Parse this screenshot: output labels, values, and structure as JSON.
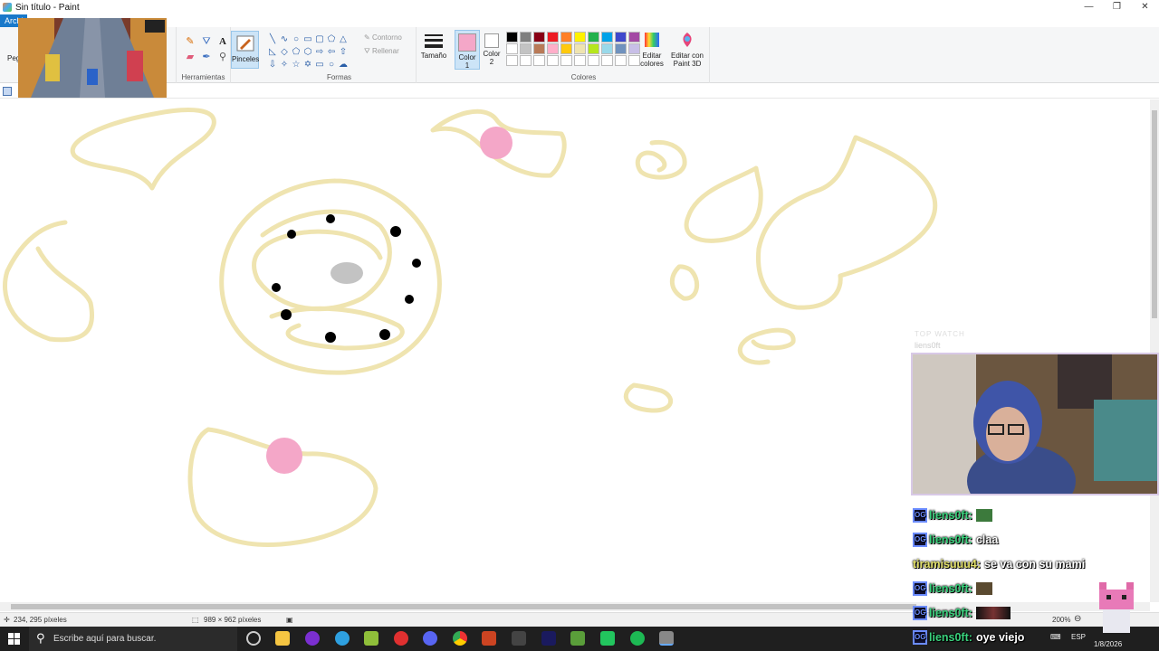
{
  "window": {
    "title": "Sin título - Paint",
    "controls": [
      "—",
      "❐",
      "✕"
    ]
  },
  "ribbon": {
    "file_tab": "Archivo",
    "paste_label": "Pegar",
    "groups": {
      "tools_label": "Herramientas",
      "shapes_label": "Formas",
      "colors_label": "Colores"
    },
    "brushes_label": "Pinceles",
    "outline_label": "Contorno",
    "fill_label": "Rellenar",
    "size_label": "Tamaño",
    "color1_label": "Color",
    "color1_num": "1",
    "color2_label": "Color",
    "color2_num": "2",
    "edit_colors_line1": "Editar",
    "edit_colors_line2": "colores",
    "paint3d_line1": "Editar con",
    "paint3d_line2": "Paint 3D",
    "color1": "#f4a7c8",
    "color2": "#ffffff",
    "palette_row1": [
      "#000000",
      "#7f7f7f",
      "#880015",
      "#ed1c24",
      "#ff7f27",
      "#fff200",
      "#22b14c",
      "#00a2e8",
      "#3f48cc",
      "#a349a4"
    ],
    "palette_row2": [
      "#ffffff",
      "#c3c3c3",
      "#b97a57",
      "#ffaec9",
      "#ffc90e",
      "#efe4b0",
      "#b5e61d",
      "#99d9ea",
      "#7092be",
      "#c8bfe7"
    ],
    "palette_row3": [
      "#ffffff",
      "#ffffff",
      "#ffffff",
      "#ffffff",
      "#ffffff",
      "#ffffff",
      "#ffffff",
      "#ffffff",
      "#ffffff",
      "#ffffff"
    ]
  },
  "canvas": {
    "stroke_color": "#efe4b0",
    "pink": "#f4a7c8",
    "dot": "#000000",
    "grey": "#c3c3c3"
  },
  "status": {
    "cursor_pos": "234, 295 píxeles",
    "canvas_size": "989 × 962 píxeles",
    "zoom": "200%"
  },
  "taskbar": {
    "search_placeholder": "Escribe aquí para buscar.",
    "lang": "ESP",
    "date": "1/8/2026"
  },
  "stream": {
    "top_label": "TOP WATCH",
    "streamer_name": "liens0ft",
    "chat": [
      {
        "user": "liens0ft:",
        "msg": "",
        "emote": "icon"
      },
      {
        "user": "liens0ft:",
        "msg": "claa",
        "emote": ""
      },
      {
        "user": "tiramisuuu4:",
        "msg": "se va con su mami",
        "emote": ""
      },
      {
        "user": "liens0ft:",
        "msg": "",
        "emote": "icon"
      },
      {
        "user": "liens0ft:",
        "msg": "",
        "emote": "wide"
      },
      {
        "user": "liens0ft:",
        "msg": "oye viejo",
        "emote": ""
      }
    ]
  }
}
